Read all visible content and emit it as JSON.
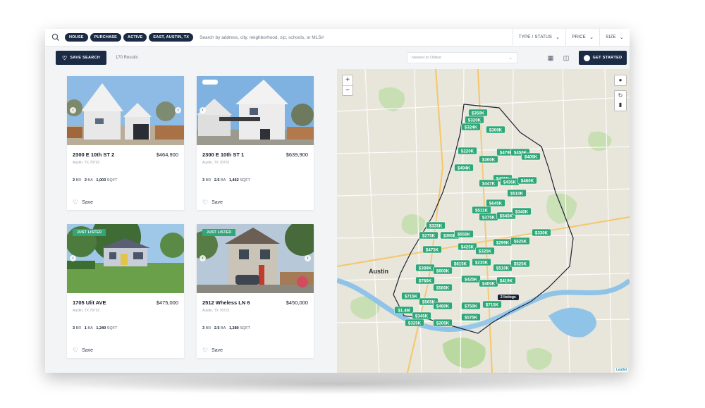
{
  "search": {
    "chips": [
      "HOUSE",
      "PURCHASE",
      "ACTIVE",
      "EAST, AUSTIN, TX"
    ],
    "placeholder": "Search by address, city, neighborhood, zip, schools, or MLS#"
  },
  "filters": {
    "type_status": "TYPE / STATUS",
    "price": "PRICE",
    "size": "SIZE"
  },
  "toolbar": {
    "save_search": "SAVE SEARCH",
    "results": "170 Results",
    "sort": "Newest to Oldest",
    "get_started": "GET STARTED"
  },
  "listings": [
    {
      "address": "2300 E 10th ST 2",
      "price": "$464,900",
      "city": "Austin, TX 78702",
      "br": "2",
      "ba": "2",
      "sqft": "1,003",
      "save": "Save",
      "badge": ""
    },
    {
      "address": "2300 E 10th ST 1",
      "price": "$639,900",
      "city": "Austin, TX 78702",
      "br": "3",
      "ba": "2.5",
      "sqft": "1,462",
      "save": "Save",
      "badge": ""
    },
    {
      "address": "1705 Ulit AVE",
      "price": "$475,000",
      "city": "Austin, TX 78702",
      "br": "3",
      "ba": "1",
      "sqft": "1,240",
      "save": "Save",
      "badge": "JUST LISTED"
    },
    {
      "address": "2512 Wheless LN 6",
      "price": "$450,000",
      "city": "Austin, TX 78723",
      "br": "3",
      "ba": "2.5",
      "sqft": "1,280",
      "save": "Save",
      "badge": "JUST LISTED"
    }
  ],
  "spec_labels": {
    "br": "BR",
    "ba": "BA",
    "sqft": "SQFT"
  },
  "map": {
    "city_label": "Austin",
    "listings_tooltip": "2 listings",
    "attribution": "Leaflet",
    "zoom_in": "+",
    "zoom_out": "−",
    "pins": [
      "$350K",
      "$320K",
      "$324K",
      "$309K",
      "$220K",
      "$494K",
      "$360K",
      "$479K",
      "$450K",
      "$405K",
      "$425K",
      "$447K",
      "$435K",
      "$460K",
      "$510K",
      "$511K",
      "$645K",
      "$375K",
      "$545K",
      "$340K",
      "$335K",
      "$275K",
      "$390K",
      "$555K",
      "$475K",
      "$425K",
      "$325K",
      "$299K",
      "$625K",
      "$330K",
      "$389K",
      "$600K",
      "$615K",
      "$235K",
      "$510K",
      "$525K",
      "$780K",
      "$580K",
      "$425K",
      "$400K",
      "$419K",
      "$715K",
      "$565K",
      "$1.4M",
      "$345K",
      "$480K",
      "$750K",
      "$715K",
      "$325K",
      "$205K",
      "$575K"
    ],
    "colors": {
      "pin": "#2fa778",
      "boundary": "#1c2333",
      "water": "#8fc4e8",
      "park": "#b9d9a1",
      "land": "#e9e6dc"
    }
  }
}
